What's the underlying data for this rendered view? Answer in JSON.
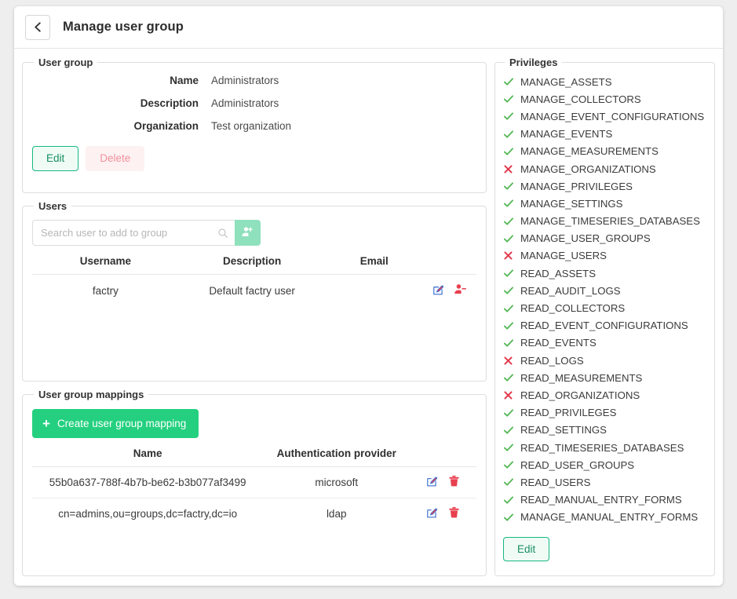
{
  "header": {
    "title": "Manage user group",
    "back_icon": "chevron-left-icon"
  },
  "user_group": {
    "legend": "User group",
    "fields": [
      {
        "label": "Name",
        "value": "Administrators"
      },
      {
        "label": "Description",
        "value": "Administrators"
      },
      {
        "label": "Organization",
        "value": "Test organization"
      }
    ],
    "edit_label": "Edit",
    "delete_label": "Delete"
  },
  "users": {
    "legend": "Users",
    "search_placeholder": "Search user to add to group",
    "search_value": "",
    "search_icon": "search-icon",
    "add_user_icon": "user-plus-icon",
    "columns": [
      "Username",
      "Description",
      "Email"
    ],
    "rows": [
      {
        "username": "factry",
        "description": "Default factry user",
        "email": "",
        "edit_icon": "pencil-square-icon",
        "remove_icon": "user-minus-icon"
      }
    ]
  },
  "mappings": {
    "legend": "User group mappings",
    "create_label": "Create user group mapping",
    "create_icon": "plus-icon",
    "columns": [
      "Name",
      "Authentication provider"
    ],
    "rows": [
      {
        "name": "55b0a637-788f-4b7b-be62-b3b077af3499",
        "provider": "microsoft",
        "edit_icon": "pencil-square-icon",
        "delete_icon": "trash-icon"
      },
      {
        "name": "cn=admins,ou=groups,dc=factry,dc=io",
        "provider": "ldap",
        "edit_icon": "pencil-square-icon",
        "delete_icon": "trash-icon"
      }
    ]
  },
  "privileges": {
    "legend": "Privileges",
    "edit_label": "Edit",
    "granted_icon": "check-icon",
    "denied_icon": "cross-icon",
    "items": [
      {
        "name": "MANAGE_ASSETS",
        "granted": true
      },
      {
        "name": "MANAGE_COLLECTORS",
        "granted": true
      },
      {
        "name": "MANAGE_EVENT_CONFIGURATIONS",
        "granted": true
      },
      {
        "name": "MANAGE_EVENTS",
        "granted": true
      },
      {
        "name": "MANAGE_MEASUREMENTS",
        "granted": true
      },
      {
        "name": "MANAGE_ORGANIZATIONS",
        "granted": false
      },
      {
        "name": "MANAGE_PRIVILEGES",
        "granted": true
      },
      {
        "name": "MANAGE_SETTINGS",
        "granted": true
      },
      {
        "name": "MANAGE_TIMESERIES_DATABASES",
        "granted": true
      },
      {
        "name": "MANAGE_USER_GROUPS",
        "granted": true
      },
      {
        "name": "MANAGE_USERS",
        "granted": false
      },
      {
        "name": "READ_ASSETS",
        "granted": true
      },
      {
        "name": "READ_AUDIT_LOGS",
        "granted": true
      },
      {
        "name": "READ_COLLECTORS",
        "granted": true
      },
      {
        "name": "READ_EVENT_CONFIGURATIONS",
        "granted": true
      },
      {
        "name": "READ_EVENTS",
        "granted": true
      },
      {
        "name": "READ_LOGS",
        "granted": false
      },
      {
        "name": "READ_MEASUREMENTS",
        "granted": true
      },
      {
        "name": "READ_ORGANIZATIONS",
        "granted": false
      },
      {
        "name": "READ_PRIVILEGES",
        "granted": true
      },
      {
        "name": "READ_SETTINGS",
        "granted": true
      },
      {
        "name": "READ_TIMESERIES_DATABASES",
        "granted": true
      },
      {
        "name": "READ_USER_GROUPS",
        "granted": true
      },
      {
        "name": "READ_USERS",
        "granted": true
      },
      {
        "name": "READ_MANUAL_ENTRY_FORMS",
        "granted": true
      },
      {
        "name": "MANAGE_MANUAL_ENTRY_FORMS",
        "granted": true
      }
    ]
  },
  "colors": {
    "page_background": "#eeeeee",
    "card_background": "#ffffff",
    "accent_green": "#24d07f",
    "accent_green_muted": "#8fe0bd",
    "outline_green_border": "#15b881",
    "outline_green_text": "#17905f",
    "outline_green_bg": "#f0fbf6",
    "danger_red": "#e8404f",
    "danger_disabled_text": "#f1919c",
    "danger_disabled_bg": "#fdf1f2",
    "granted_green": "#55b857",
    "denied_red": "#e2384a",
    "icon_blue": "#3b6fd4",
    "icon_red": "#e8404f",
    "text_primary": "#2d2d2d",
    "text_secondary": "#4a4a4a",
    "border": "#dedede"
  }
}
